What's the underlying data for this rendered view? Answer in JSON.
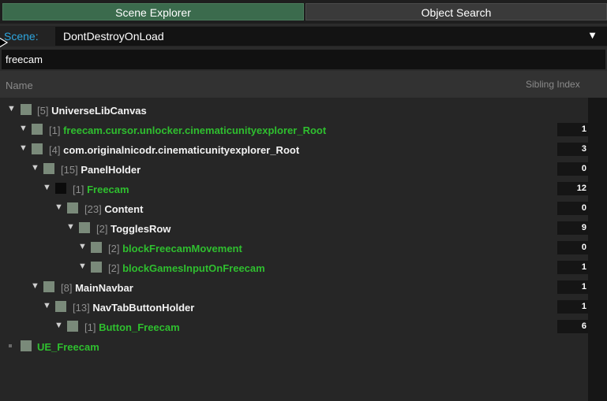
{
  "tabs": {
    "scene_explorer": "Scene Explorer",
    "object_search": "Object Search"
  },
  "scene": {
    "label": "Scene:",
    "value": "DontDestroyOnLoad"
  },
  "search": {
    "value": "freecam"
  },
  "columns": {
    "name": "Name",
    "sibling_index": "Sibling Index"
  },
  "tree": [
    {
      "index": "[5]",
      "name": "UniverseLibCanvas",
      "green": false,
      "sibling": ""
    },
    {
      "index": "[1]",
      "name": "freecam.cursor.unlocker.cinematicunityexplorer_Root",
      "green": true,
      "sibling": "1"
    },
    {
      "index": "[4]",
      "name": "com.originalnicodr.cinematicunityexplorer_Root",
      "green": false,
      "sibling": "3"
    },
    {
      "index": "[15]",
      "name": "PanelHolder",
      "green": false,
      "sibling": "0"
    },
    {
      "index": "[1]",
      "name": "Freecam",
      "green": true,
      "sibling": "12"
    },
    {
      "index": "[23]",
      "name": "Content",
      "green": false,
      "sibling": "0"
    },
    {
      "index": "[2]",
      "name": "TogglesRow",
      "green": false,
      "sibling": "9"
    },
    {
      "index": "[2]",
      "name": "blockFreecamMovement",
      "green": true,
      "sibling": "0"
    },
    {
      "index": "[2]",
      "name": "blockGamesInputOnFreecam",
      "green": true,
      "sibling": "1"
    },
    {
      "index": "[8]",
      "name": "MainNavbar",
      "green": false,
      "sibling": "1"
    },
    {
      "index": "[13]",
      "name": "NavTabButtonHolder",
      "green": false,
      "sibling": "1"
    },
    {
      "index": "[1]",
      "name": "Button_Freecam",
      "green": true,
      "sibling": "6"
    },
    {
      "index": "",
      "name": "UE_Freecam",
      "green": true,
      "sibling": ""
    }
  ],
  "colors": {
    "tab_active": "#3b6b4d",
    "scene_label": "#2ea7e0",
    "match_green": "#2fbf2f"
  }
}
